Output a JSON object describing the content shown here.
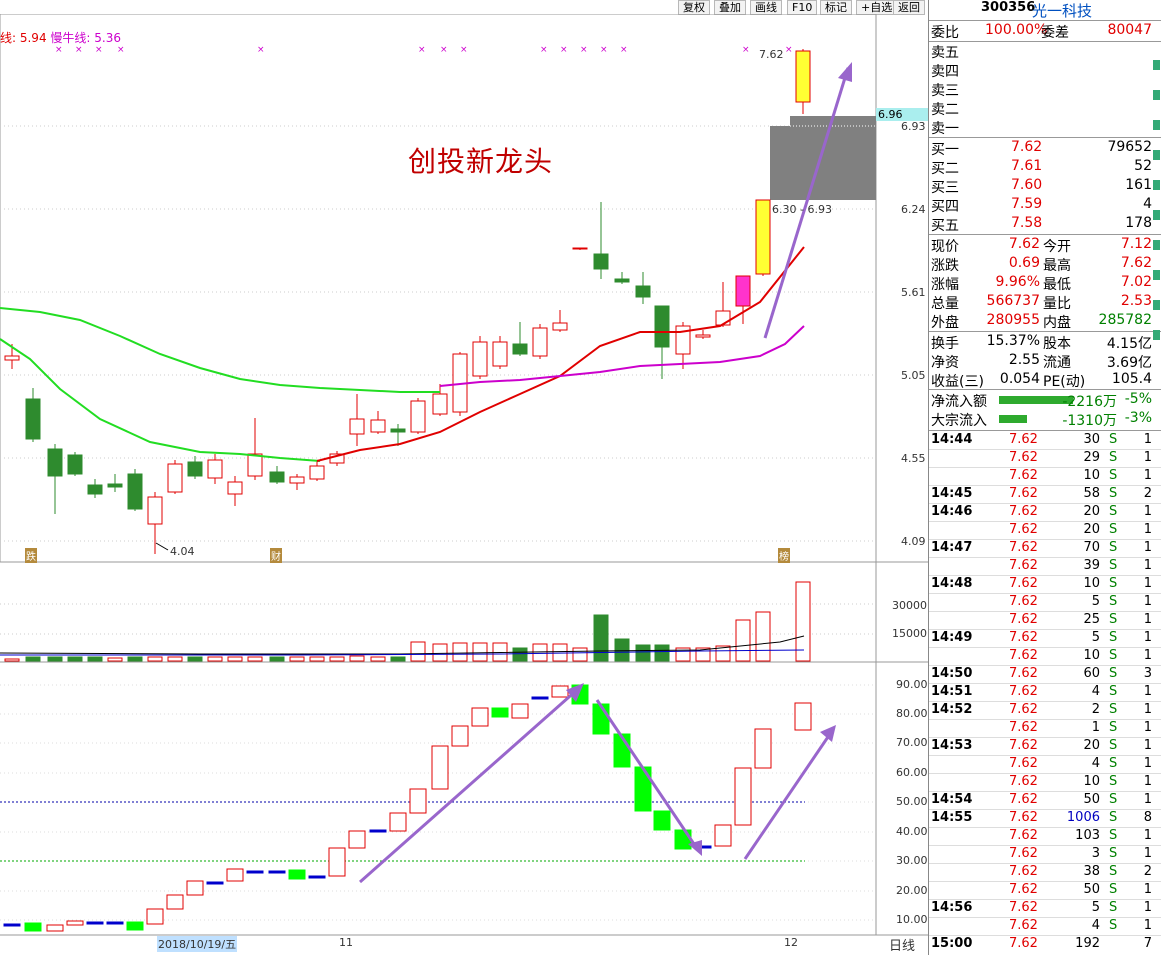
{
  "toolbar": {
    "buttons": [
      "复权",
      "叠加",
      "画线",
      "F10",
      "标记",
      "+自选",
      "返回"
    ]
  },
  "chart": {
    "ma_legend": [
      {
        "label": "线: 5.94",
        "color": "#e00000"
      },
      {
        "label": "慢牛线: 5.36",
        "color": "#cc00cc"
      }
    ],
    "title_overlay": "创投新龙头",
    "price_axis": [
      "6.93",
      "6.24",
      "5.61",
      "5.05",
      "4.55",
      "4.09"
    ],
    "current_price_tag": "6.96",
    "high_label": "7.62",
    "low_label": "4.04",
    "gap_label": "6.30 - 6.93",
    "markers": [
      "跌",
      "财",
      "榜"
    ],
    "volume_axis": [
      "30000",
      "15000"
    ],
    "osc_axis": [
      "90.00",
      "80.00",
      "70.00",
      "60.00",
      "50.00",
      "40.00",
      "30.00",
      "20.00",
      "10.00"
    ],
    "date_axis": [
      "2018/10/19/五",
      "11",
      "12"
    ],
    "period": "日线",
    "colors": {
      "up": "#e00000",
      "down": "#2e8b2e",
      "ma_short": "#e00000",
      "ma_slow": "#cc00cc",
      "ma_long": "#22dd22",
      "arrow": "#9966cc"
    }
  },
  "panel": {
    "code": "300356",
    "name": "光一科技",
    "weibi_label": "委比",
    "weibi_value": "100.00%",
    "weicha_label": "委差",
    "weicha_value": "80047",
    "asks": [
      "卖五",
      "卖四",
      "卖三",
      "卖二",
      "卖一"
    ],
    "bids": [
      {
        "label": "买一",
        "price": "7.62",
        "vol": "79652"
      },
      {
        "label": "买二",
        "price": "7.61",
        "vol": "52"
      },
      {
        "label": "买三",
        "price": "7.60",
        "vol": "161"
      },
      {
        "label": "买四",
        "price": "7.59",
        "vol": "4"
      },
      {
        "label": "买五",
        "price": "7.58",
        "vol": "178"
      }
    ],
    "stats": [
      {
        "l1": "现价",
        "v1": "7.62",
        "l2": "今开",
        "v2": "7.12"
      },
      {
        "l1": "涨跌",
        "v1": "0.69",
        "l2": "最高",
        "v2": "7.62"
      },
      {
        "l1": "涨幅",
        "v1": "9.96%",
        "l2": "最低",
        "v2": "7.02"
      },
      {
        "l1": "总量",
        "v1": "566737",
        "l2": "量比",
        "v2": "2.53"
      },
      {
        "l1": "外盘",
        "v1": "280955",
        "l2": "内盘",
        "v2": "285782"
      }
    ],
    "stats2": [
      {
        "l1": "换手",
        "v1": "15.37%",
        "l2": "股本",
        "v2": "4.15亿"
      },
      {
        "l1": "净资",
        "v1": "2.55",
        "l2": "流通",
        "v2": "3.69亿"
      },
      {
        "l1": "收益(三)",
        "v1": "0.054",
        "l2": "PE(动)",
        "v2": "105.4"
      }
    ],
    "flows": [
      {
        "label": "净流入额",
        "value": "-2216万",
        "pct": "-5%"
      },
      {
        "label": "大宗流入",
        "value": "-1310万",
        "pct": "-3%"
      }
    ],
    "trades": [
      {
        "t": "14:44",
        "p": "7.62",
        "v": "30",
        "s": "S",
        "n": "1"
      },
      {
        "t": "",
        "p": "7.62",
        "v": "29",
        "s": "S",
        "n": "1"
      },
      {
        "t": "",
        "p": "7.62",
        "v": "10",
        "s": "S",
        "n": "1"
      },
      {
        "t": "14:45",
        "p": "7.62",
        "v": "58",
        "s": "S",
        "n": "2"
      },
      {
        "t": "14:46",
        "p": "7.62",
        "v": "20",
        "s": "S",
        "n": "1"
      },
      {
        "t": "",
        "p": "7.62",
        "v": "20",
        "s": "S",
        "n": "1"
      },
      {
        "t": "14:47",
        "p": "7.62",
        "v": "70",
        "s": "S",
        "n": "1"
      },
      {
        "t": "",
        "p": "7.62",
        "v": "39",
        "s": "S",
        "n": "1"
      },
      {
        "t": "14:48",
        "p": "7.62",
        "v": "10",
        "s": "S",
        "n": "1"
      },
      {
        "t": "",
        "p": "7.62",
        "v": "5",
        "s": "S",
        "n": "1"
      },
      {
        "t": "",
        "p": "7.62",
        "v": "25",
        "s": "S",
        "n": "1"
      },
      {
        "t": "14:49",
        "p": "7.62",
        "v": "5",
        "s": "S",
        "n": "1"
      },
      {
        "t": "",
        "p": "7.62",
        "v": "10",
        "s": "S",
        "n": "1"
      },
      {
        "t": "14:50",
        "p": "7.62",
        "v": "60",
        "s": "S",
        "n": "3"
      },
      {
        "t": "14:51",
        "p": "7.62",
        "v": "4",
        "s": "S",
        "n": "1"
      },
      {
        "t": "14:52",
        "p": "7.62",
        "v": "2",
        "s": "S",
        "n": "1"
      },
      {
        "t": "",
        "p": "7.62",
        "v": "1",
        "s": "S",
        "n": "1"
      },
      {
        "t": "14:53",
        "p": "7.62",
        "v": "20",
        "s": "S",
        "n": "1"
      },
      {
        "t": "",
        "p": "7.62",
        "v": "4",
        "s": "S",
        "n": "1"
      },
      {
        "t": "",
        "p": "7.62",
        "v": "10",
        "s": "S",
        "n": "1"
      },
      {
        "t": "14:54",
        "p": "7.62",
        "v": "50",
        "s": "S",
        "n": "1"
      },
      {
        "t": "14:55",
        "p": "7.62",
        "v": "1006",
        "s": "S",
        "n": "8"
      },
      {
        "t": "",
        "p": "7.62",
        "v": "103",
        "s": "S",
        "n": "1"
      },
      {
        "t": "",
        "p": "7.62",
        "v": "3",
        "s": "S",
        "n": "1"
      },
      {
        "t": "",
        "p": "7.62",
        "v": "38",
        "s": "S",
        "n": "2"
      },
      {
        "t": "",
        "p": "7.62",
        "v": "50",
        "s": "S",
        "n": "1"
      },
      {
        "t": "14:56",
        "p": "7.62",
        "v": "5",
        "s": "S",
        "n": "1"
      },
      {
        "t": "",
        "p": "7.62",
        "v": "4",
        "s": "S",
        "n": "1"
      },
      {
        "t": "15:00",
        "p": "7.62",
        "v": "192",
        "s": "",
        "n": "7"
      }
    ]
  }
}
